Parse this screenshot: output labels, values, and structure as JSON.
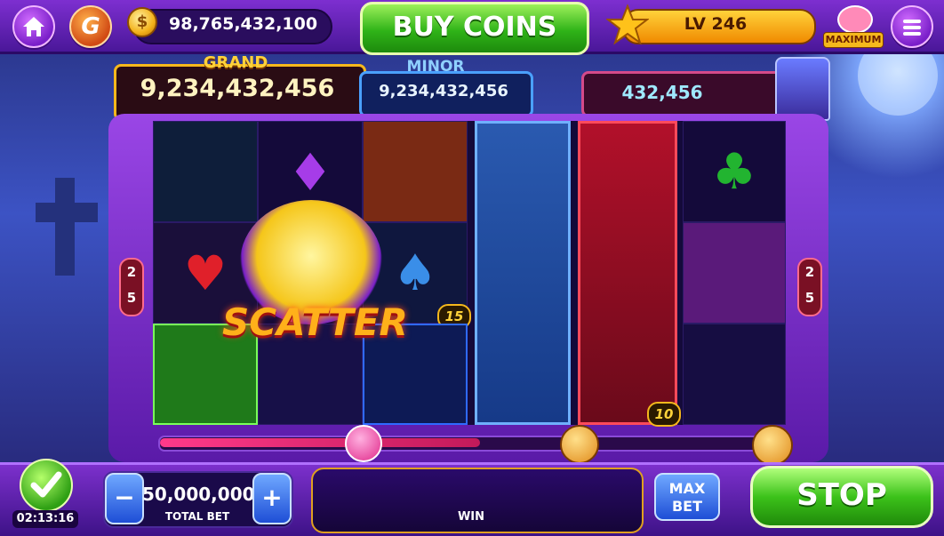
{
  "topbar": {
    "coin_balance": "98,765,432,100",
    "buy_coins_label": "BUY COINS",
    "level_label": "LV 246",
    "maximum_badge": "MAXIMUM",
    "coin_symbol": "$",
    "logo_letter": "G"
  },
  "jackpots": {
    "grand_label": "GRAND",
    "grand_value": "9,234,432,456",
    "minor_label": "MINOR",
    "minor_value": "9,234,432,456",
    "third_value": "432,456"
  },
  "reels": {
    "left_lines_top": "2",
    "left_lines_bottom": "5",
    "right_lines_top": "2",
    "right_lines_bottom": "5",
    "scatter_label": "SCATTER",
    "badge_15": "15",
    "badge_10": "10",
    "spade_symbol": "♠",
    "heart_symbol": "♥",
    "diamond_symbol": "♦",
    "club_symbol": "♣"
  },
  "bottombar": {
    "timer": "02:13:16",
    "bet_value": "50,000,000",
    "total_bet_label": "TOTAL BET",
    "minus_label": "−",
    "plus_label": "+",
    "win_label": "WIN",
    "max_bet_line1": "MAX",
    "max_bet_line2": "BET",
    "stop_label": "STOP"
  },
  "colors": {
    "accent_green": "#2fb318",
    "jackpot_gold": "#f5b81c",
    "frame_purple": "#7a2fd0"
  }
}
